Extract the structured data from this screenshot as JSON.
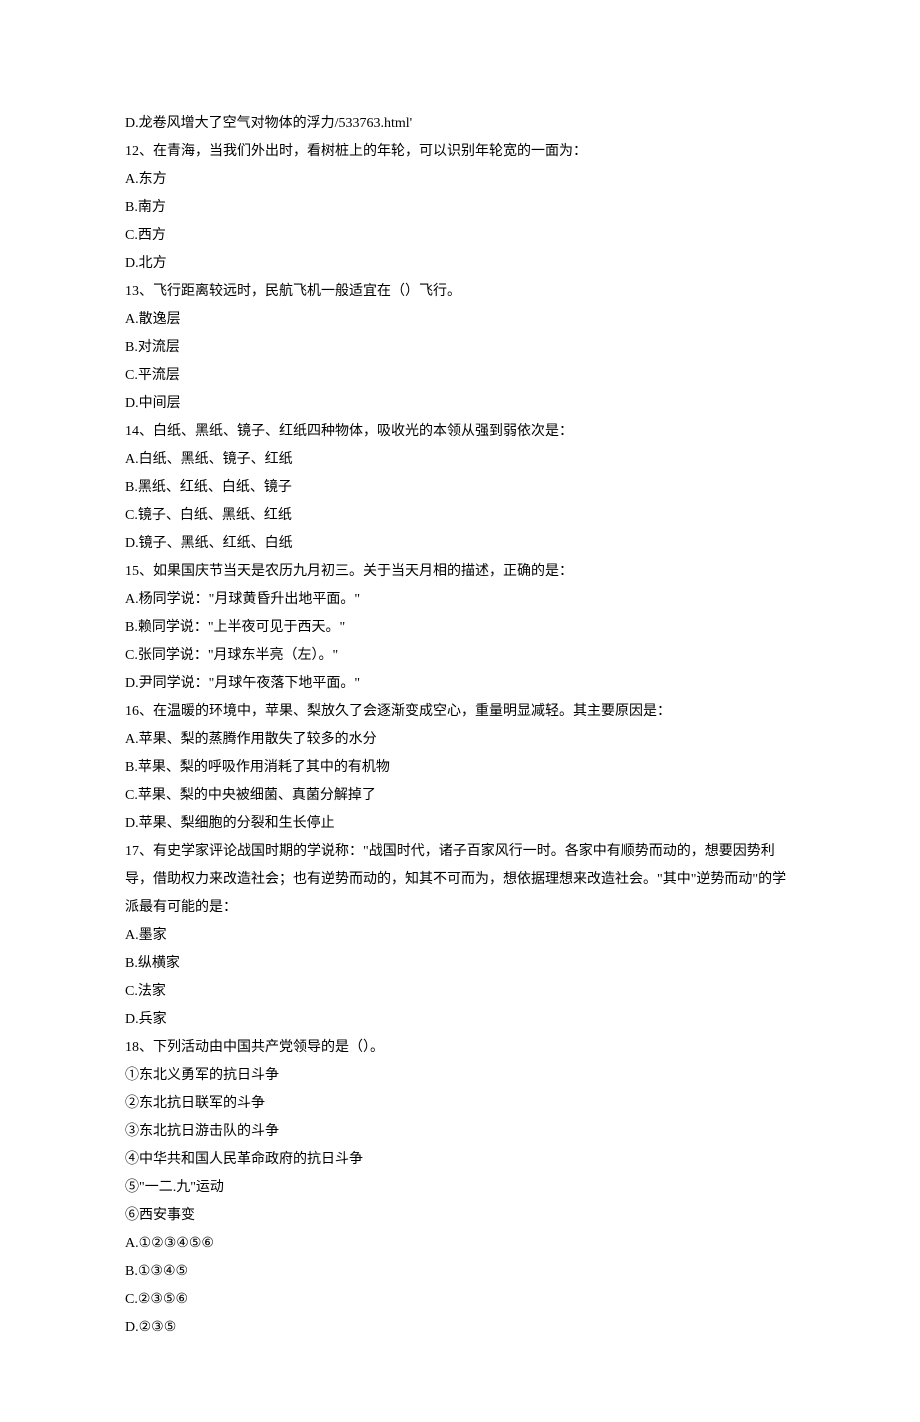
{
  "lines": [
    "D.龙卷风增大了空气对物体的浮力/533763.html'",
    "12、在青海，当我们外出时，看树桩上的年轮，可以识别年轮宽的一面为：",
    "A.东方",
    "B.南方",
    "C.西方",
    "D.北方",
    "13、飞行距离较远时，民航飞机一般适宜在（）飞行。",
    "A.散逸层",
    "B.对流层",
    "C.平流层",
    "D.中间层",
    "14、白纸、黑纸、镜子、红纸四种物体，吸收光的本领从强到弱依次是：",
    "A.白纸、黑纸、镜子、红纸",
    "B.黑纸、红纸、白纸、镜子",
    "C.镜子、白纸、黑纸、红纸",
    "D.镜子、黑纸、红纸、白纸",
    "15、如果国庆节当天是农历九月初三。关于当天月相的描述，正确的是：",
    "A.杨同学说：\"月球黄昏升出地平面。\"",
    "B.赖同学说：\"上半夜可见于西天。\"",
    "C.张同学说：\"月球东半亮（左）。\"",
    "D.尹同学说：\"月球午夜落下地平面。\"",
    "16、在温暖的环境中，苹果、梨放久了会逐渐变成空心，重量明显减轻。其主要原因是：",
    "A.苹果、梨的蒸腾作用散失了较多的水分",
    "B.苹果、梨的呼吸作用消耗了其中的有机物",
    "C.苹果、梨的中央被细菌、真菌分解掉了",
    "D.苹果、梨细胞的分裂和生长停止",
    "17、有史学家评论战国时期的学说称：\"战国时代，诸子百家风行一时。各家中有顺势而动的，想要因势利导，借助权力来改造社会；也有逆势而动的，知其不可而为，想依据理想来改造社会。\"其中\"逆势而动\"的学派最有可能的是：",
    "A.墨家",
    "B.纵横家",
    "C.法家",
    "D.兵家",
    "18、下列活动由中国共产党领导的是（）。",
    "①东北义勇军的抗日斗争",
    "②东北抗日联军的斗争",
    "③东北抗日游击队的斗争",
    "④中华共和国人民革命政府的抗日斗争",
    "⑤\"一二.九\"运动",
    "⑥西安事变",
    "A.①②③④⑤⑥",
    "B.①③④⑤",
    "C.②③⑤⑥",
    "D.②③⑤"
  ]
}
